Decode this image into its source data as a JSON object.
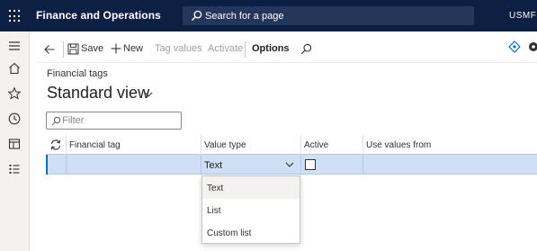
{
  "app": {
    "title": "Finance and Operations",
    "company": "USMF",
    "search_text": "Search for a page"
  },
  "left_nav": {
    "items": [
      "hamburger-icon",
      "home-icon",
      "star-icon",
      "clock-icon",
      "workspace-icon",
      "list-icon"
    ]
  },
  "action_pane": {
    "save": "Save",
    "new": "New",
    "tag_values": "Tag values",
    "activate": "Activate",
    "options": "Options"
  },
  "page": {
    "breadcrumb": "Financial tags",
    "view_title": "Standard view",
    "filter_placeholder": "Filter"
  },
  "grid": {
    "columns": [
      "Financial tag",
      "Value type",
      "Active",
      "Use values from"
    ],
    "rows": [
      {
        "financial_tag": "",
        "value_type": "Text",
        "active": false,
        "use_values_from": ""
      }
    ]
  },
  "dropdown": {
    "options": [
      "Text",
      "List",
      "Custom list"
    ],
    "highlighted": "Text"
  },
  "colors": {
    "topbar": "#0d1f43",
    "search": "#24365a",
    "row_selected": "#cfdff5",
    "accent": "#0f6cbd"
  }
}
